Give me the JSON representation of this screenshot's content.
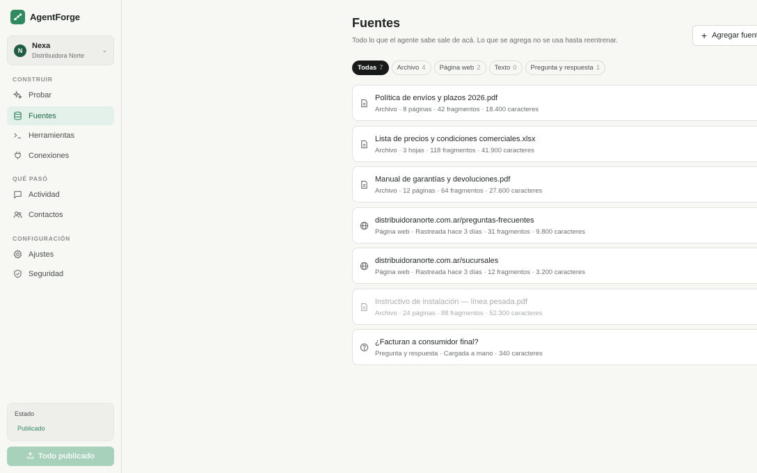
{
  "brand": {
    "name": "AgentForge"
  },
  "workspace": {
    "initial": "N",
    "name": "Nexa",
    "org": "Distribuidora Norte"
  },
  "nav": {
    "sections": [
      {
        "title": "CONSTRUIR",
        "items": [
          {
            "label": "Probar",
            "icon": "sparkles-icon"
          },
          {
            "label": "Fuentes",
            "icon": "database-icon",
            "active": true
          },
          {
            "label": "Herramientas",
            "icon": "terminal-icon"
          },
          {
            "label": "Conexiones",
            "icon": "plug-icon"
          }
        ]
      },
      {
        "title": "QUÉ PASÓ",
        "items": [
          {
            "label": "Actividad",
            "icon": "chat-icon"
          },
          {
            "label": "Contactos",
            "icon": "users-icon"
          }
        ]
      },
      {
        "title": "CONFIGURACIÓN",
        "items": [
          {
            "label": "Ajustes",
            "icon": "gear-icon"
          },
          {
            "label": "Seguridad",
            "icon": "shield-icon"
          }
        ]
      }
    ]
  },
  "status": {
    "label": "Estado",
    "value": "Publicado"
  },
  "publish_button": "Todo publicado",
  "page": {
    "title": "Fuentes",
    "subtitle": "Todo lo que el agente sabe sale de acá. Lo que se agrega no se usa hasta reentrenar.",
    "add_button": "Agregar fuente"
  },
  "filters": [
    {
      "label": "Todas",
      "count": "7",
      "active": true
    },
    {
      "label": "Archivo",
      "count": "4"
    },
    {
      "label": "Página web",
      "count": "2"
    },
    {
      "label": "Texto",
      "count": "0"
    },
    {
      "label": "Pregunta y respuesta",
      "count": "1"
    }
  ],
  "sources": [
    {
      "title": "Política de envíos y plazos 2026.pdf",
      "meta": "Archivo · 8 páginas · 42 fragmentos · 18.400 caracteres",
      "icon": "file-icon"
    },
    {
      "title": "Lista de precios y condiciones comerciales.xlsx",
      "meta": "Archivo · 3 hojas · 118 fragmentos · 41.900 caracteres",
      "icon": "file-icon"
    },
    {
      "title": "Manual de garantías y devoluciones.pdf",
      "meta": "Archivo · 12 páginas · 64 fragmentos · 27.600 caracteres",
      "icon": "file-icon"
    },
    {
      "title": "distribuidoranorte.com.ar/preguntas-frecuentes",
      "meta": "Página web · Rastreada hace 3 días · 31 fragmentos · 9.800 caracteres",
      "icon": "globe-icon"
    },
    {
      "title": "distribuidoranorte.com.ar/sucursales",
      "meta": "Página web · Rastreada hace 3 días · 12 fragmentos · 3.200 caracteres",
      "icon": "globe-icon"
    },
    {
      "title": "Instructivo de instalación — línea pesada.pdf",
      "meta": "Archivo · 24 páginas · 88 fragmentos · 52.300 caracteres",
      "icon": "file-icon",
      "disabled": true
    },
    {
      "title": "¿Facturan a consumidor final?",
      "meta": "Pregunta y respuesta · Cargada a mano · 340 caracteres",
      "icon": "question-icon"
    }
  ],
  "colors": {
    "accent": "#2f8a5f",
    "active_bg": "#e4f1ea",
    "chip_active": "#161a18",
    "publish": "#a7d1bb"
  }
}
